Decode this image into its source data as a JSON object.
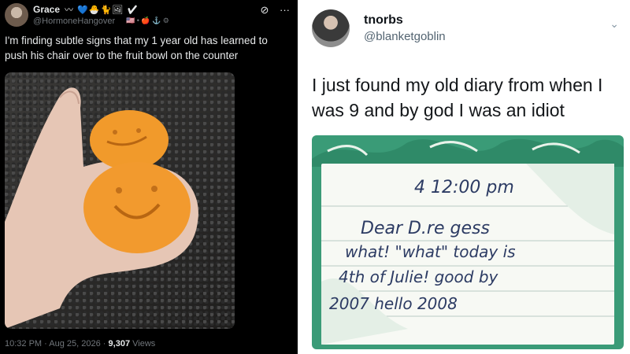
{
  "left_tweet": {
    "display_name": "Grace",
    "name_emojis": "〰 💙🐣🐈🖼 ✔",
    "handle": "@HormoneHangover",
    "handle_flags": "🇺🇸 • 🍎 ⚓ ⚙",
    "actions": {
      "grok_icon": "⊘",
      "more_icon": "···"
    },
    "text": "I'm finding subtle signs that my 1 year old has learned to push his chair over to the fruit bowl on the counter",
    "photo_alt": "hand holding two oranges with bite-like faces",
    "time": "10:32 PM",
    "date": "Aug 25, 2026",
    "views_count": "9,307",
    "views_label": "Views"
  },
  "right_tweet": {
    "display_name": "tnorbs",
    "handle": "@blanketgoblin",
    "chevron_icon": "chevron-down-icon",
    "text": "I just found my old diary from when I was 9 and by god I was an idiot",
    "diary": {
      "line1": "4  12:00 pm",
      "line2": "Dear D.re gess",
      "line3": "what! \"what\" today is",
      "line4": "4th of Julie! good by",
      "line5": "2007 hello 2008"
    }
  }
}
